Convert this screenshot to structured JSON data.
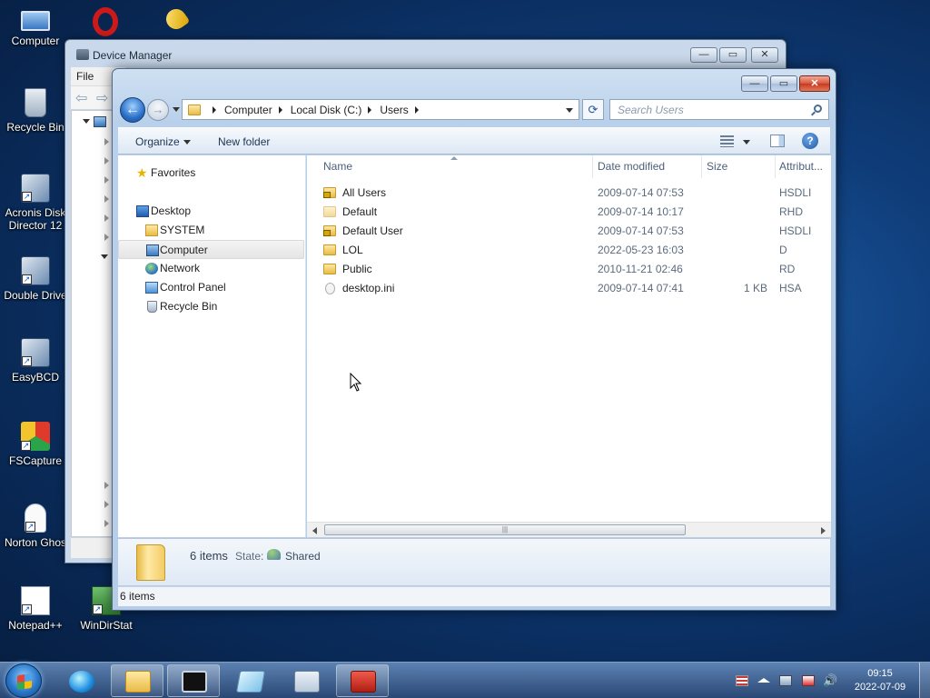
{
  "desktop": {
    "icons": [
      {
        "label": "Computer",
        "icon": "computer-icon"
      },
      {
        "label": "",
        "icon": "opera-icon"
      },
      {
        "label": "",
        "icon": "key-icon"
      },
      {
        "label": "Recycle Bin",
        "icon": "recycle-bin-icon"
      },
      {
        "label": "Acronis Disk Director 12",
        "line1": "Acronis Disk",
        "line2": "Director 12",
        "icon": "acronis-icon"
      },
      {
        "label": "Double Drive",
        "icon": "double-driver-icon"
      },
      {
        "label": "EasyBCD",
        "icon": "easybcd-icon"
      },
      {
        "label": "FSCapture",
        "icon": "fscapture-icon"
      },
      {
        "label": "Norton Ghos",
        "icon": "norton-ghost-icon"
      },
      {
        "label": "Notepad++",
        "icon": "notepad-plus-plus-icon"
      },
      {
        "label": "WinDirStat",
        "icon": "windirstat-icon"
      }
    ]
  },
  "device_manager": {
    "title": "Device Manager",
    "menu_file": "File"
  },
  "explorer": {
    "breadcrumb": [
      "Computer",
      "Local Disk (C:)",
      "Users"
    ],
    "search_placeholder": "Search Users",
    "commands": {
      "organize": "Organize",
      "new_folder": "New folder"
    },
    "nav": {
      "favorites": "Favorites",
      "desktop": "Desktop",
      "system": "SYSTEM",
      "computer": "Computer",
      "network": "Network",
      "control_panel": "Control Panel",
      "recycle_bin": "Recycle Bin"
    },
    "columns": {
      "name": "Name",
      "date": "Date modified",
      "size": "Size",
      "attr": "Attribut..."
    },
    "files": [
      {
        "name": "All Users",
        "date": "2009-07-14 07:53",
        "size": "",
        "attr": "HSDLI",
        "kind": "folder-locked"
      },
      {
        "name": "Default",
        "date": "2009-07-14 10:17",
        "size": "",
        "attr": "RHD",
        "kind": "folder-hidden"
      },
      {
        "name": "Default User",
        "date": "2009-07-14 07:53",
        "size": "",
        "attr": "HSDLI",
        "kind": "folder-locked"
      },
      {
        "name": "LOL",
        "date": "2022-05-23 16:03",
        "size": "",
        "attr": "D",
        "kind": "folder"
      },
      {
        "name": "Public",
        "date": "2010-11-21 02:46",
        "size": "",
        "attr": "RD",
        "kind": "folder"
      },
      {
        "name": "desktop.ini",
        "date": "2009-07-14 07:41",
        "size": "1 KB",
        "attr": "HSA",
        "kind": "file"
      }
    ],
    "details": {
      "count": "6 items",
      "state_label": "State:",
      "state_value": "Shared"
    },
    "status": "6 items"
  },
  "taskbar": {
    "clock_time": "09:15",
    "clock_date": "2022-07-09"
  }
}
